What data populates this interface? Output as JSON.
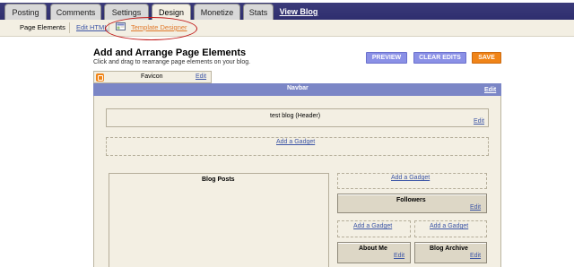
{
  "tabs": [
    {
      "label": "Posting"
    },
    {
      "label": "Comments"
    },
    {
      "label": "Settings"
    },
    {
      "label": "Design"
    },
    {
      "label": "Monetize"
    },
    {
      "label": "Stats"
    },
    {
      "label": "View Blog"
    }
  ],
  "subnav": {
    "page_elements": "Page Elements",
    "edit_html": "Edit HTML",
    "template_designer": "Template Designer"
  },
  "header": {
    "title": "Add and Arrange Page Elements",
    "subtitle": "Click and drag to rearrange page elements on your blog."
  },
  "buttons": {
    "preview": "PREVIEW",
    "clear_edits": "CLEAR EDITS",
    "save": "SAVE"
  },
  "favicon": {
    "label": "Favicon",
    "edit": "Edit"
  },
  "navbar": {
    "label": "Navbar",
    "edit": "Edit"
  },
  "header_widget": {
    "label": "test blog (Header)",
    "edit": "Edit"
  },
  "add_gadget": "Add a Gadget",
  "blog_posts": {
    "label": "Blog Posts"
  },
  "followers": {
    "label": "Followers",
    "edit": "Edit"
  },
  "about_me": {
    "label": "About Me",
    "edit": "Edit"
  },
  "blog_archive": {
    "label": "Blog Archive",
    "edit": "Edit"
  },
  "colors": {
    "tabbar": "#2e2e6e",
    "beige": "#f3efe3",
    "navbar": "#7b86c6",
    "button_blue": "#8a90e6",
    "save_orange": "#f08418",
    "link": "#3d56a6",
    "highlight_oval": "#c01818"
  }
}
